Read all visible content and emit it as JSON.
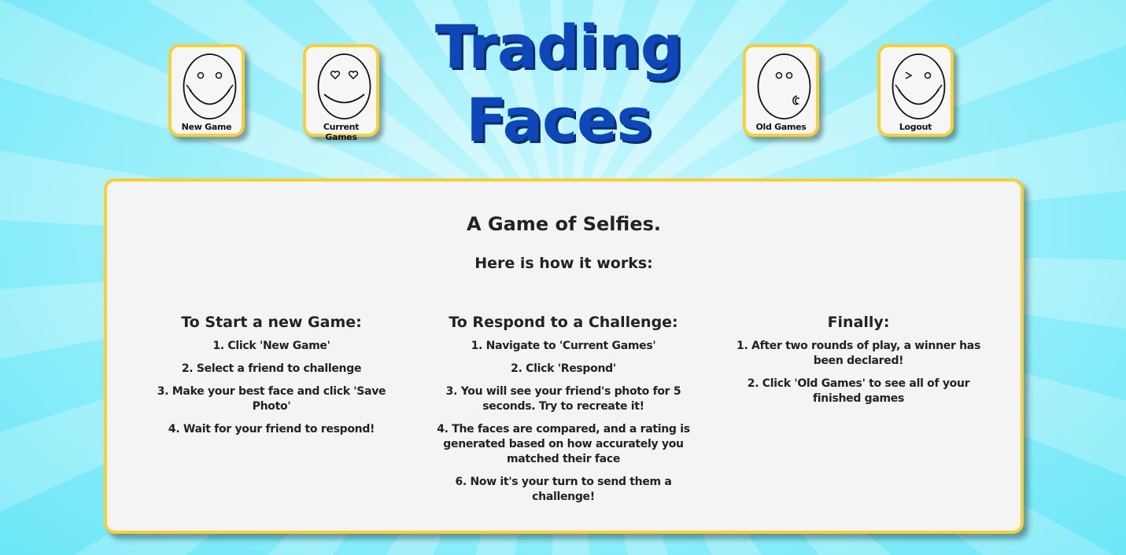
{
  "title": {
    "line1": "Trading",
    "line2": "Faces"
  },
  "nav": [
    {
      "label": "New Game",
      "icon": "smile-icon"
    },
    {
      "label": "Current Games",
      "icon": "heart-eyes-icon"
    },
    {
      "label": "Old Games",
      "icon": "kiss-icon"
    },
    {
      "label": "Logout",
      "icon": "wink-icon"
    }
  ],
  "panel": {
    "heading": "A Game of Selfies.",
    "subheading": "Here is how it works:",
    "columns": [
      {
        "title": "To Start a new Game:",
        "steps": [
          "1. Click 'New Game'",
          "2. Select a friend to challenge",
          "3. Make your best face and click 'Save Photo'",
          "4. Wait for your friend to respond!"
        ]
      },
      {
        "title": "To Respond to a Challenge:",
        "steps": [
          "1. Navigate to 'Current Games'",
          "2. Click 'Respond'",
          "3. You will see your friend's photo for 5 seconds. Try to recreate it!",
          "4. The faces are compared, and a rating is generated based on how accurately you matched their face",
          "6. Now it's your turn to send them a challenge!"
        ]
      },
      {
        "title": "Finally:",
        "steps": [
          "1. After two rounds of play, a winner has been declared!",
          "2. Click 'Old Games' to see all of your finished games"
        ]
      }
    ]
  },
  "colors": {
    "accent": "#f7cf3a",
    "title": "#0e48b8",
    "panel": "#f4f4f4"
  }
}
